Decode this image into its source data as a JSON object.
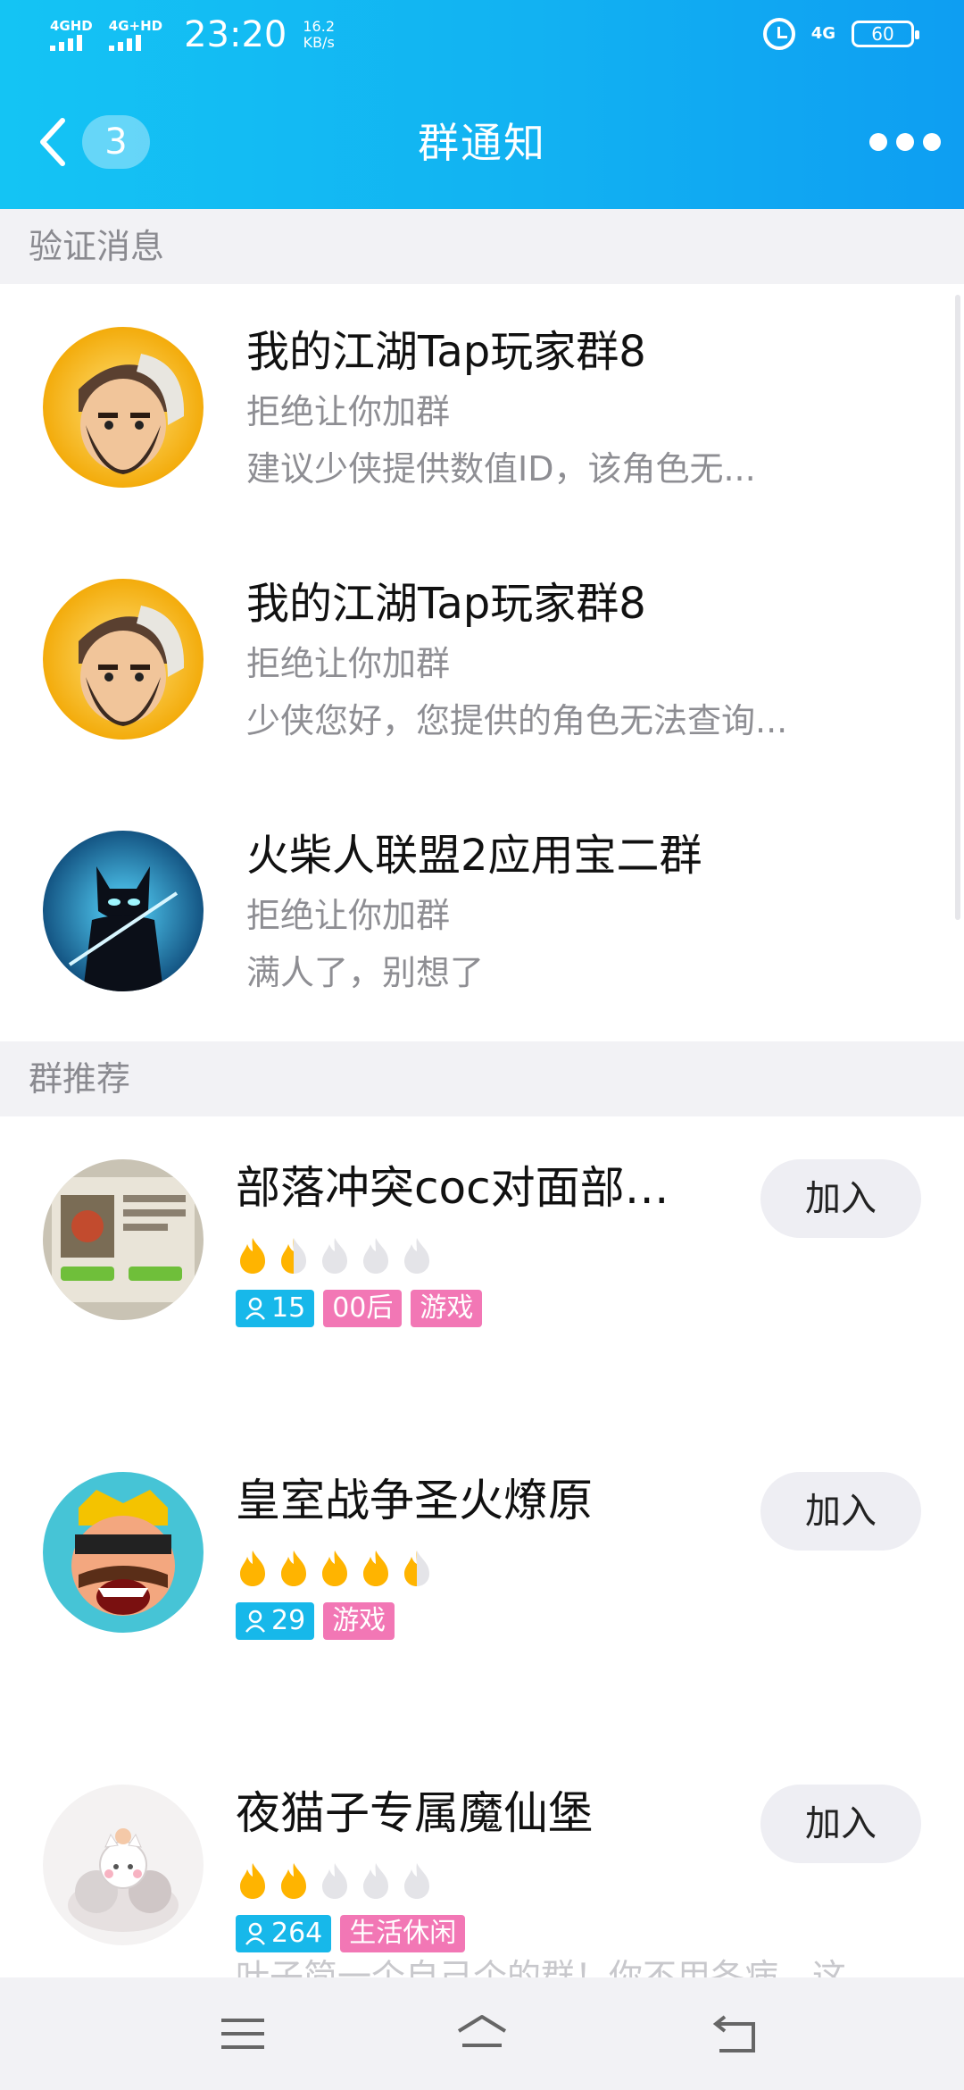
{
  "status_bar": {
    "sim1": "4GHD",
    "sim2": "4G+HD",
    "time": "23:20",
    "speed_value": "16.2",
    "speed_unit": "KB/s",
    "network": "4G",
    "battery": "60"
  },
  "navbar": {
    "back_badge": "3",
    "title": "群通知",
    "more_icon": "more-dots-icon"
  },
  "sections": {
    "verification": "验证消息",
    "recommend": "群推荐"
  },
  "notifications": [
    {
      "group": "我的江湖Tap玩家群8",
      "status": "拒绝让你加群",
      "message": "建议少侠提供数值ID，该角色无..."
    },
    {
      "group": "我的江湖Tap玩家群8",
      "status": "拒绝让你加群",
      "message": "少侠您好，您提供的角色无法查询..."
    },
    {
      "group": "火柴人联盟2应用宝二群",
      "status": "拒绝让你加群",
      "message": "满人了，别想了"
    }
  ],
  "recommendations": [
    {
      "name": "部落冲突coc对面部…",
      "heat_rating": 1.5,
      "members": "15",
      "tags": [
        "00后",
        "游戏"
      ],
      "join_label": "加入"
    },
    {
      "name": "皇室战争圣火燎原",
      "heat_rating": 4.5,
      "members": "29",
      "tags": [
        "游戏"
      ],
      "join_label": "加入"
    },
    {
      "name": "夜猫子专属魔仙堡",
      "heat_rating": 2,
      "members": "264",
      "tags": [
        "生活休闲"
      ],
      "join_label": "加入"
    }
  ],
  "truncated_description": "叶子简一个自己个的群！你不用各病，这",
  "colors": {
    "header_start": "#14c4f4",
    "header_end": "#0e9ef2",
    "member_tag": "#17b8ea",
    "category_tag": "#f277b5",
    "flame_active": "#ffb400"
  }
}
